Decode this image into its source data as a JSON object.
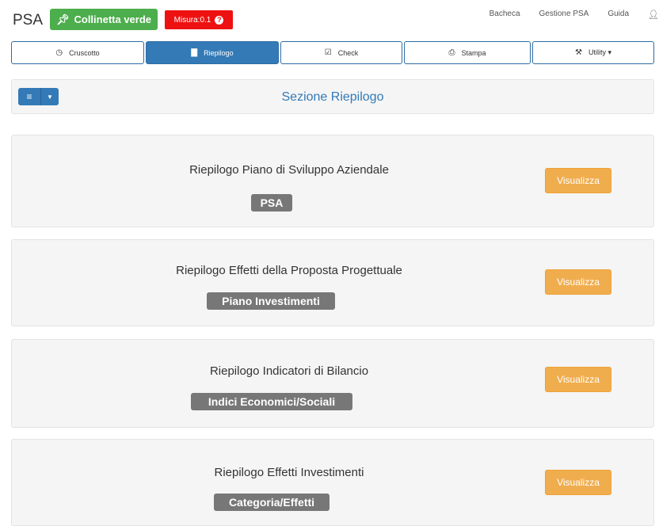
{
  "header": {
    "brand": "PSA",
    "project_tag": "Collinetta verde",
    "measure_tag": "Misura:0.1",
    "links": [
      "Bacheca",
      "Gestione PSA",
      "Guida"
    ]
  },
  "tabs": [
    {
      "label": "Cruscotto",
      "icon": "dashboard-icon",
      "active": false
    },
    {
      "label": "Riepilogo",
      "icon": "bar-chart-icon",
      "active": true
    },
    {
      "label": "Check",
      "icon": "check-square-icon",
      "active": false
    },
    {
      "label": "Stampa",
      "icon": "print-icon",
      "active": false
    },
    {
      "label": "Utility ▾",
      "icon": "wrench-icon",
      "active": false
    }
  ],
  "section": {
    "title": "Sezione Riepilogo"
  },
  "cards": [
    {
      "title": "Riepilogo Piano di Sviluppo Aziendale",
      "label": "PSA",
      "button": "Visualizza"
    },
    {
      "title": "Riepilogo Effetti della Proposta Progettuale",
      "label": "Piano Investimenti",
      "button": "Visualizza"
    },
    {
      "title": "Riepilogo Indicatori di Bilancio",
      "label": "Indici Economici/Sociali",
      "button": "Visualizza"
    },
    {
      "title": "Riepilogo Effetti Investimenti",
      "label": "Categoria/Effetti",
      "button": "Visualizza"
    }
  ],
  "colors": {
    "primary": "#337ab7",
    "success": "#4cae4c",
    "danger": "#ee1111",
    "warning": "#f0ad4e",
    "label_default": "#777777"
  }
}
